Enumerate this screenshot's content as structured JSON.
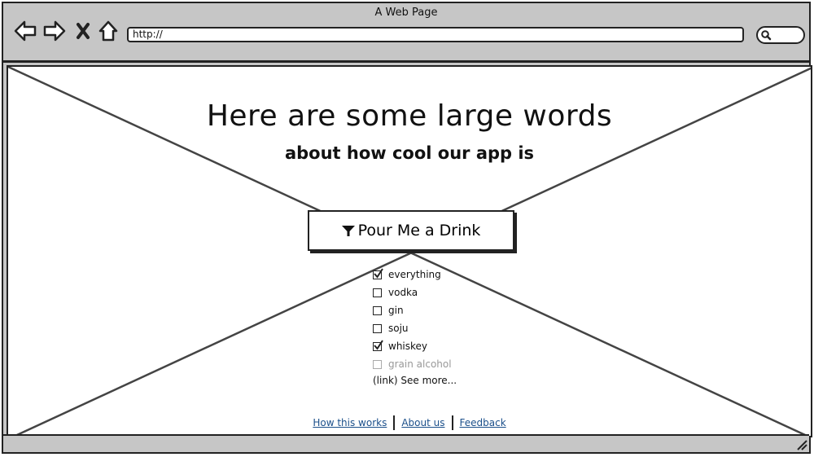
{
  "window": {
    "title": "A Web Page",
    "url_value": "http://"
  },
  "hero": {
    "headline": "Here are some large words",
    "subheadline": "about how cool our app is",
    "cta_label": "Pour Me a Drink",
    "cta_icon": "funnel-icon"
  },
  "filters": [
    {
      "label": "everything",
      "checked": true,
      "disabled": false
    },
    {
      "label": "vodka",
      "checked": false,
      "disabled": false
    },
    {
      "label": "gin",
      "checked": false,
      "disabled": false
    },
    {
      "label": "soju",
      "checked": false,
      "disabled": false
    },
    {
      "label": "whiskey",
      "checked": true,
      "disabled": false
    },
    {
      "label": "grain alcohol",
      "checked": false,
      "disabled": true
    }
  ],
  "see_more": "(link) See more...",
  "footer": {
    "links": [
      "How this works",
      "About us",
      "Feedback"
    ]
  },
  "colors": {
    "link": "#1b4f8a",
    "chrome": "#c6c6c6"
  }
}
